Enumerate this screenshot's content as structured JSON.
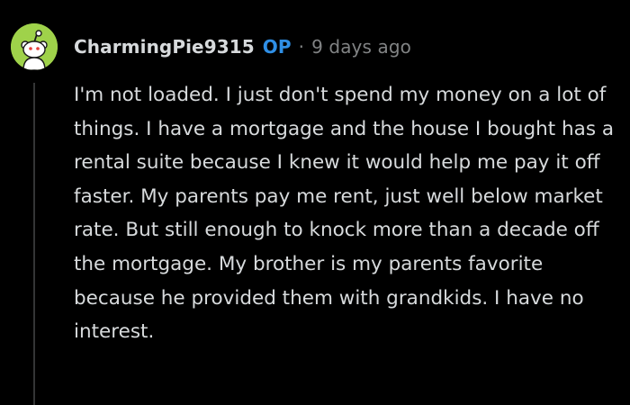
{
  "comment": {
    "username": "CharmingPie9315",
    "op_badge": "OP",
    "separator": "·",
    "timestamp": "9 days ago",
    "avatar_icon": "snoo-avatar-icon",
    "avatar_color": "#9fd24a",
    "body": "I'm not loaded. I just don't spend my money on a lot of things. I have a mortgage and the house I bought has a rental suite because I knew it would help me pay it off faster. My parents pay me rent, just well below market rate. But still enough to knock more than a decade off the mortgage. My brother is my parents favorite because he provided them with grandkids. I have no interest."
  },
  "colors": {
    "background": "#000000",
    "text": "#d7dadc",
    "muted": "#818384",
    "op_accent": "#2f8fe6",
    "thread_line": "#343536"
  }
}
